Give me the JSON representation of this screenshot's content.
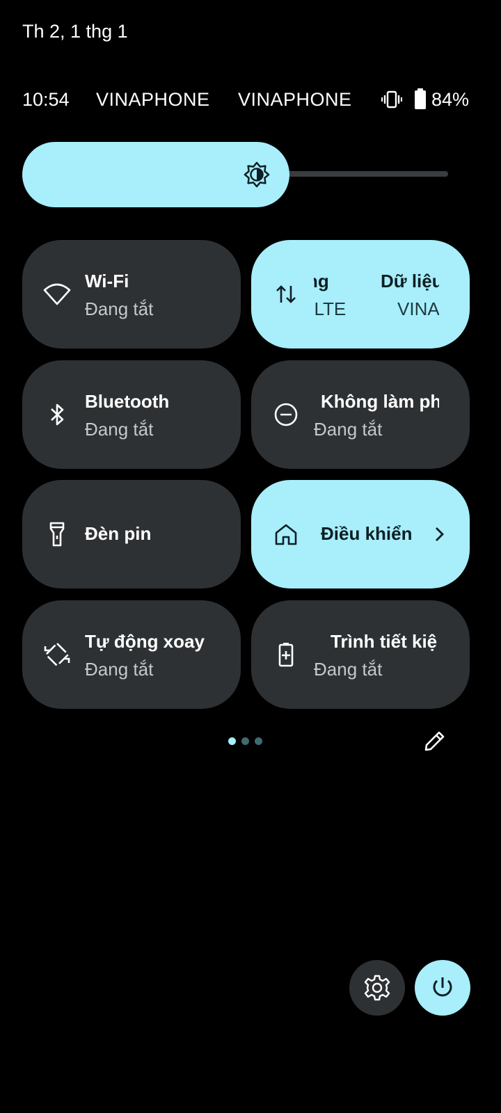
{
  "header": {
    "date": "Th 2, 1 thg 1"
  },
  "status_bar": {
    "time": "10:54",
    "carrier_1": "VINAPHONE",
    "carrier_2": "VINAPHONE",
    "battery_percent": "84%",
    "icons": [
      "vibrate-icon",
      "battery-icon"
    ]
  },
  "brightness": {
    "level": 0.56,
    "icon": "brightness-icon"
  },
  "tiles": {
    "wifi": {
      "title": "Wi-Fi",
      "subtitle": "Đang tắt",
      "icon": "wifi-icon",
      "active": false
    },
    "mobile_data": {
      "title_fragment_1": "ng",
      "subtitle_fragment_1": ", LTE",
      "title_fragment_2": "Dữ liệu",
      "subtitle_fragment_2": "VINA",
      "icon": "data-arrows-icon",
      "active": true
    },
    "bluetooth": {
      "title": "Bluetooth",
      "subtitle": "Đang tắt",
      "icon": "bluetooth-icon",
      "active": false
    },
    "dnd": {
      "title": "Không làm ph",
      "subtitle": "Đang tắt",
      "icon": "do-not-disturb-icon",
      "active": false
    },
    "flashlight": {
      "title": "Đèn pin",
      "icon": "flashlight-icon",
      "active": false
    },
    "home_controls": {
      "title": "Điều khiển",
      "icon": "home-icon",
      "active": true
    },
    "auto_rotate": {
      "title": "Tự động xoay",
      "subtitle": "Đang tắt",
      "icon": "rotate-icon",
      "active": false
    },
    "battery_saver": {
      "title": "Trình tiết kiệ",
      "subtitle": "Đang tắt",
      "icon": "battery-saver-icon",
      "active": false
    }
  },
  "pager": {
    "pages": 3,
    "current": 1
  },
  "colors": {
    "accent": "#a8eefb",
    "tile_off": "#2e3133",
    "background": "#000000"
  }
}
